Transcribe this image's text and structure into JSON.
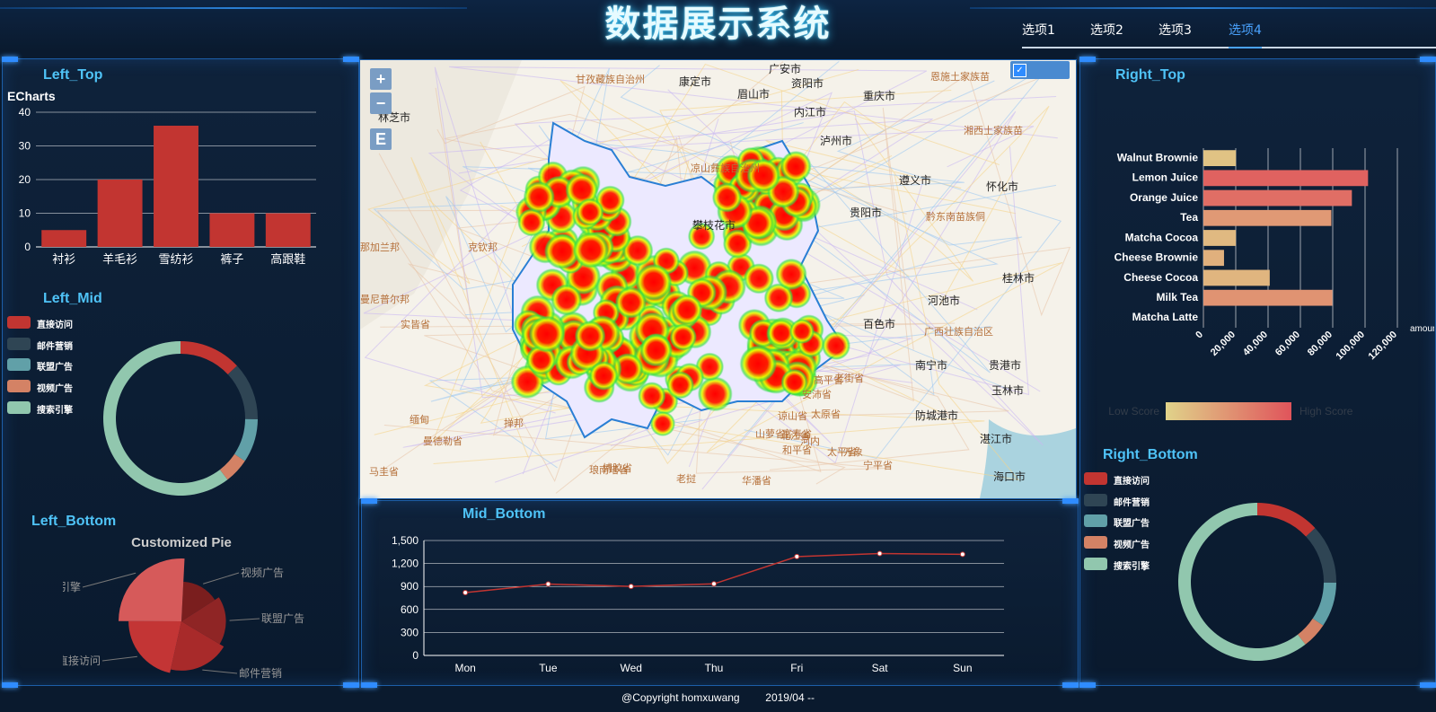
{
  "header": {
    "title": "数据展示系统",
    "tabs": [
      {
        "label": "选项1",
        "active": false
      },
      {
        "label": "选项2",
        "active": false
      },
      {
        "label": "选项3",
        "active": false
      },
      {
        "label": "选项4",
        "active": true
      }
    ]
  },
  "panels": {
    "left_top": "Left_Top",
    "left_mid": "Left_Mid",
    "left_bottom": "Left_Bottom",
    "right_top": "Right_Top",
    "right_bottom": "Right_Bottom",
    "mid_bottom": "Mid_Bottom"
  },
  "map": {
    "zoom_in": "+",
    "zoom_out": "−",
    "export": "E",
    "labels": [
      "甘孜藏族自治州",
      "康定市",
      "眉山市",
      "资阳市",
      "广安市",
      "重庆市",
      "恩施土家族苗族自治州",
      "内江市",
      "泸州市",
      "林芝市",
      "湘西土家族苗族自治州",
      "遵义市",
      "怀化市",
      "凉山彝族自治州",
      "攀枝花市",
      "贵阳市",
      "黔东南苗族侗族自治州",
      "那加兰邦",
      "克钦邦",
      "曼尼普尔邦",
      "实皆省",
      "掸邦",
      "缅甸",
      "曼德勒省",
      "马圭省",
      "百色市",
      "河池市",
      "桂林市",
      "广西壮族自治区",
      "南宁市",
      "贵港市",
      "玉林市",
      "防城港市",
      "湛江市",
      "海口市",
      "老挝",
      "琅南塔省",
      "博胶省",
      "华潘省",
      "高平省",
      "谅山省",
      "北江省",
      "太原省",
      "安沛省",
      "富寿省",
      "和平省",
      "太平省",
      "宁平省",
      "老街省",
      "山萝省",
      "河内",
      "万象"
    ]
  },
  "colors": {
    "bar_red": "#c23531",
    "donut": [
      "#c23531",
      "#2f4554",
      "#61a0a8",
      "#d48265",
      "#91c7ae"
    ],
    "line": "#c23531",
    "visual_map": [
      "#e0d38a",
      "#e0545b"
    ]
  },
  "chart_data": [
    {
      "id": "left_top_bar",
      "type": "bar",
      "title": "ECharts",
      "categories": [
        "衬衫",
        "羊毛衫",
        "雪纺衫",
        "裤子",
        "高跟鞋"
      ],
      "values": [
        5,
        20,
        36,
        10,
        10
      ],
      "ylim": [
        0,
        40
      ],
      "yticks": [
        0,
        10,
        20,
        30,
        40
      ],
      "grid": true
    },
    {
      "id": "left_mid_donut",
      "type": "pie",
      "donut": true,
      "legend": [
        "直接访问",
        "邮件营销",
        "联盟广告",
        "视频广告",
        "搜索引擎"
      ],
      "values": [
        335,
        310,
        234,
        135,
        1548
      ],
      "legend_position": "left"
    },
    {
      "id": "left_bottom_pie",
      "type": "pie",
      "title": "Customized Pie",
      "labels": [
        "视频广告",
        "联盟广告",
        "邮件营销",
        "直接访问",
        "搜索引擎"
      ],
      "values": [
        235,
        274,
        310,
        335,
        400
      ],
      "rose": true
    },
    {
      "id": "right_top_bar",
      "type": "bar",
      "orientation": "horizontal",
      "categories": [
        "Walnut Brownie",
        "Lemon Juice",
        "Orange Juice",
        "Tea",
        "Matcha Cocoa",
        "Cheese Brownie",
        "Cheese Cocoa",
        "Milk Tea",
        "Matcha Latte"
      ],
      "values": [
        20145,
        101852,
        91852,
        79146,
        20112,
        12755,
        41032,
        79772,
        57.1
      ],
      "score": [
        12.7,
        89.3,
        79.3,
        45.4,
        20.1,
        27.4,
        23.8,
        50.6,
        57.1
      ],
      "xlim": [
        0,
        120000
      ],
      "xticks": [
        "0",
        "20,000",
        "40,000",
        "60,000",
        "80,000",
        "100,000",
        "120,000"
      ],
      "xlabel": "amount",
      "visual_map": {
        "low_label": "Low Score",
        "high_label": "High Score"
      }
    },
    {
      "id": "right_bottom_donut",
      "type": "pie",
      "donut": true,
      "legend": [
        "直接访问",
        "邮件营销",
        "联盟广告",
        "视频广告",
        "搜索引擎"
      ],
      "values": [
        335,
        310,
        234,
        135,
        1548
      ],
      "legend_position": "left"
    },
    {
      "id": "mid_bottom_line",
      "type": "line",
      "categories": [
        "Mon",
        "Tue",
        "Wed",
        "Thu",
        "Fri",
        "Sat",
        "Sun"
      ],
      "values": [
        820,
        932,
        901,
        934,
        1290,
        1330,
        1320
      ],
      "ylim": [
        0,
        1500
      ],
      "yticks": [
        "0",
        "300",
        "600",
        "900",
        "1,200",
        "1,500"
      ],
      "grid": true
    }
  ],
  "footer": {
    "copyright": "@Copyright homxuwang",
    "date": "2019/04 --"
  }
}
